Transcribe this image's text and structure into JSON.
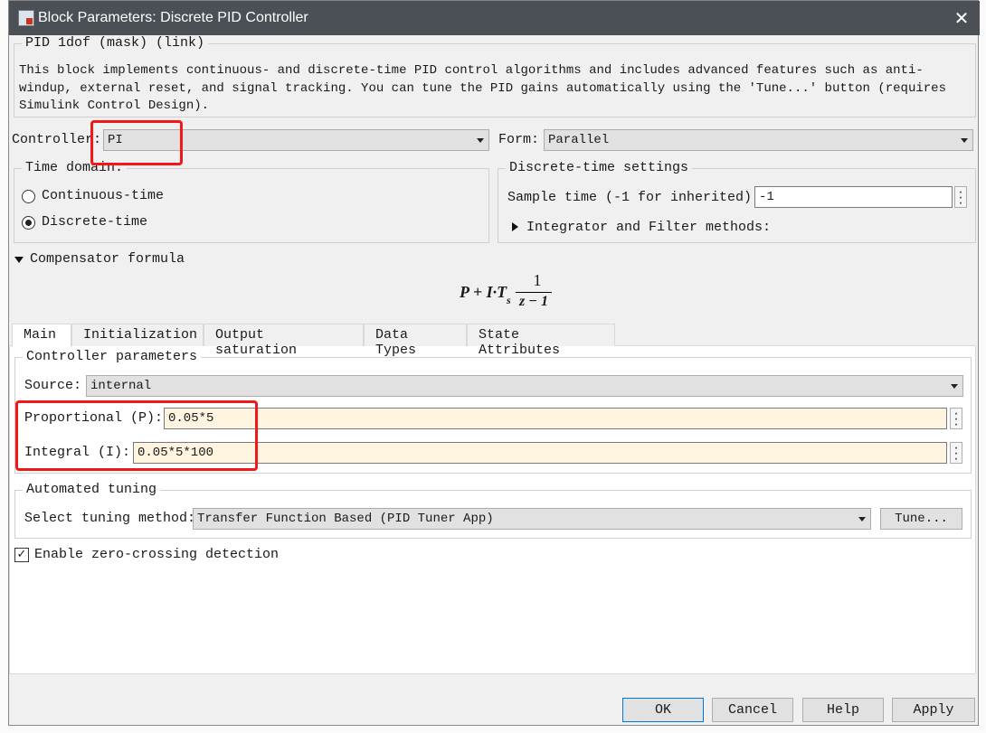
{
  "window": {
    "title": "Block Parameters: Discrete PID Controller"
  },
  "description": {
    "heading": "PID 1dof (mask) (link)",
    "lines": [
      "This block implements continuous- and discrete-time PID control algorithms and includes advanced features such as anti-",
      "windup, external reset, and signal tracking. You can tune the PID gains automatically using the 'Tune...' button (requires",
      "Simulink Control Design)."
    ]
  },
  "controller": {
    "label": "Controller:",
    "value": "PI"
  },
  "form": {
    "label": "Form:",
    "value": "Parallel"
  },
  "time_domain": {
    "legend": "Time domain:",
    "options": [
      {
        "label": "Continuous-time",
        "selected": false
      },
      {
        "label": "Discrete-time",
        "selected": true
      }
    ]
  },
  "discrete_settings": {
    "legend": "Discrete-time settings",
    "sample_time_label": "Sample time (-1 for inherited):",
    "sample_time_value": "-1",
    "methods_label": "Integrator and Filter methods:"
  },
  "compensator": {
    "label": "Compensator formula",
    "formula": {
      "lhs": "P + I·T",
      "sub": "s",
      "num": "1",
      "den": "z − 1"
    }
  },
  "tabs": [
    {
      "label": "Main",
      "active": true
    },
    {
      "label": "Initialization"
    },
    {
      "label": "Output saturation"
    },
    {
      "label": "Data Types"
    },
    {
      "label": "State Attributes"
    }
  ],
  "params": {
    "legend": "Controller parameters",
    "source_label": "Source:",
    "source_value": "internal",
    "p_label": "Proportional (P):",
    "p_value": "0.05*5",
    "i_label": "Integral (I):",
    "i_value": "0.05*5*100"
  },
  "tuning": {
    "legend": "Automated tuning",
    "method_label": "Select tuning method:",
    "method_value": "Transfer Function Based (PID Tuner App)",
    "tune_button": "Tune..."
  },
  "zero_crossing": {
    "label": "Enable zero-crossing detection",
    "checked": true
  },
  "buttons": {
    "ok": "OK",
    "cancel": "Cancel",
    "help": "Help",
    "apply": "Apply"
  },
  "annotation_color": "#f01818"
}
